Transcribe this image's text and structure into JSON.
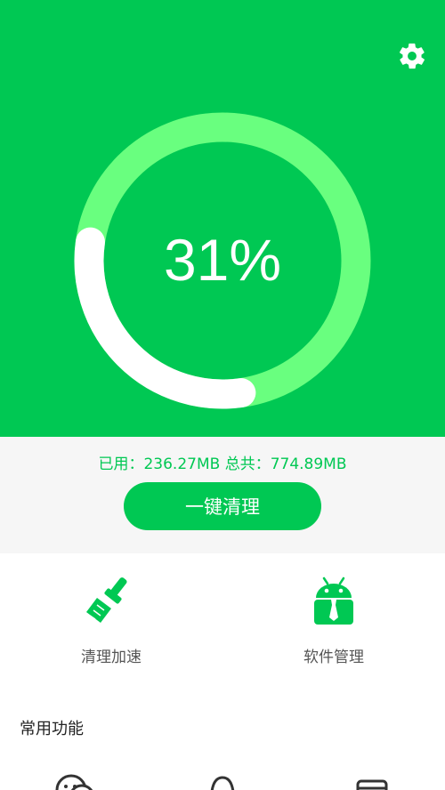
{
  "header": {
    "settings_icon": "gear-icon",
    "gauge": {
      "percent_label": "31%",
      "used_fraction": 0.31,
      "track_color": "#69ff7f",
      "progress_color": "#ffffff",
      "background_color": "#00c853"
    }
  },
  "memory": {
    "text": "已用：236.27MB 总共：774.89MB"
  },
  "actions": {
    "one_key_clean_label": "一键清理"
  },
  "tools": [
    {
      "label": "清理加速",
      "icon": "broom-icon"
    },
    {
      "label": "软件管理",
      "icon": "android-box-icon"
    }
  ],
  "common_functions": {
    "title": "常用功能",
    "items": [
      {
        "icon": "wechat-icon"
      },
      {
        "icon": "qq-icon"
      },
      {
        "icon": "box-icon"
      }
    ]
  }
}
